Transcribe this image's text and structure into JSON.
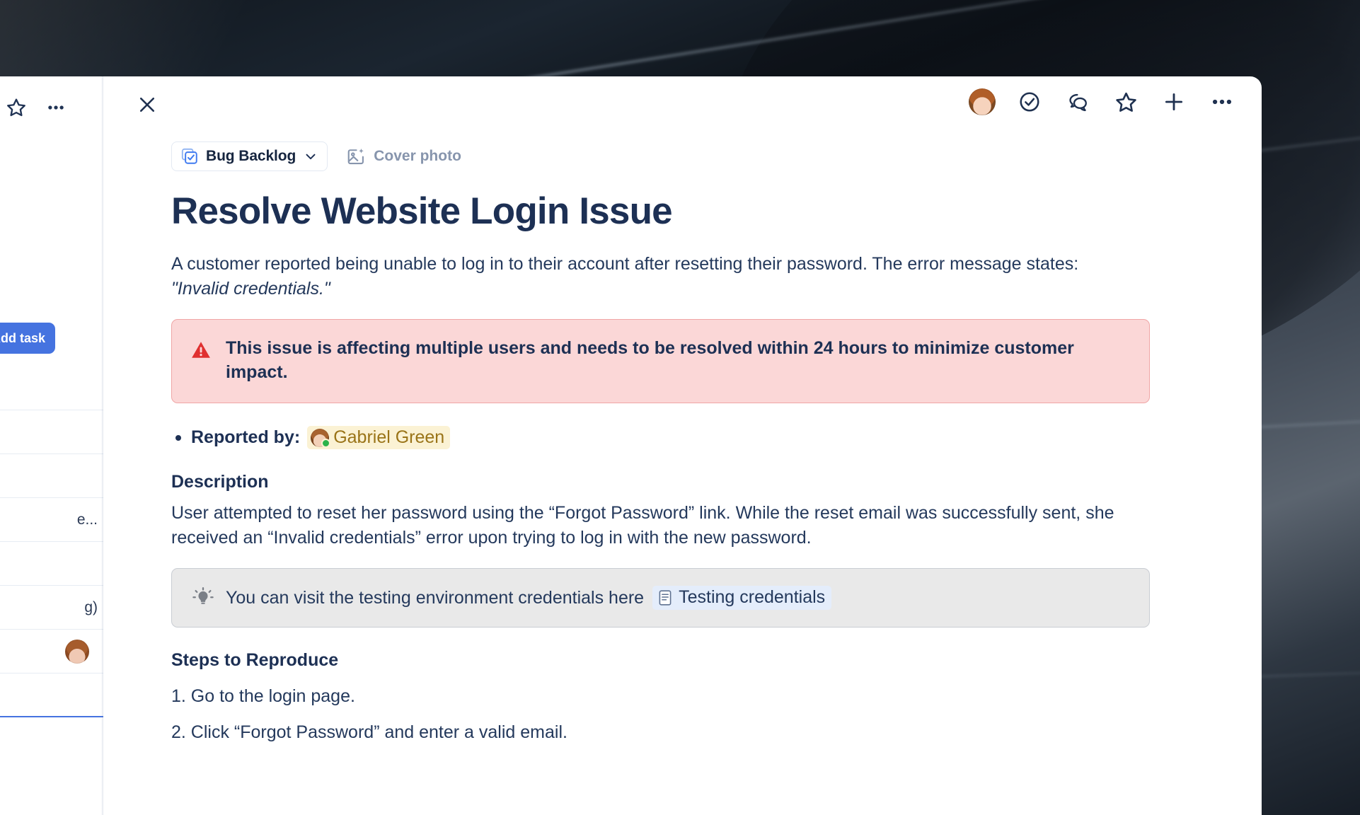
{
  "list_pane": {
    "star_icon": "star-icon",
    "more_icon": "ellipsis-icon",
    "add_task_label": "Add task",
    "rows": [
      {
        "text": ""
      },
      {
        "text": ""
      },
      {
        "text": ""
      },
      {
        "text": "e..."
      },
      {
        "text": ""
      },
      {
        "text": ""
      },
      {
        "text": "g)"
      },
      {
        "text": "",
        "has_avatar": true
      },
      {
        "text": "",
        "selected": true
      }
    ]
  },
  "task_panel": {
    "close_label": "Close",
    "header_actions": [
      {
        "name": "assignee-avatar",
        "icon": "avatar"
      },
      {
        "name": "mark-complete-button",
        "icon": "check-circle-icon"
      },
      {
        "name": "comment-button",
        "icon": "comment-icon"
      },
      {
        "name": "favorite-button",
        "icon": "star-icon"
      },
      {
        "name": "add-button",
        "icon": "plus-icon"
      },
      {
        "name": "more-options-button",
        "icon": "ellipsis-icon"
      }
    ],
    "breadcrumb": {
      "project_icon": "project-board-icon",
      "project_name": "Bug Backlog",
      "chevron_icon": "chevron-down-icon",
      "cover_photo_icon": "image-sparkle-icon",
      "cover_photo_label": "Cover photo"
    },
    "title": "Resolve Website Login Issue",
    "intro": {
      "text_before": "A customer reported being unable to log in to their account after resetting their password. The error message states: ",
      "quote": "\"Invalid credentials.\""
    },
    "alert_callout": {
      "icon": "warning-triangle-icon",
      "text": "This issue is affecting multiple users and needs to be resolved within 24 hours to minimize customer impact.",
      "background": "#fbd7d7",
      "border": "#f0a6a6"
    },
    "reported_by": {
      "label": "Reported by:",
      "mention_name": "Gabriel Green",
      "mention_background": "#fbf2d4",
      "mention_color": "#9a7418",
      "status_color": "#2bb34a"
    },
    "description": {
      "heading": "Description",
      "body": "User attempted to reset her password using the “Forgot Password” link. While the reset email was successfully sent, she received an “Invalid credentials” error upon trying to log in with the new password."
    },
    "tip_callout": {
      "icon": "lightbulb-icon",
      "text": "You can visit the testing environment credentials here",
      "doc_icon": "document-icon",
      "doc_label": "Testing credentials",
      "background": "#e9e9e9"
    },
    "steps": {
      "heading": "Steps to Reproduce",
      "items": [
        "1. Go to the login page.",
        "2. Click “Forgot Password” and enter a valid email."
      ]
    }
  }
}
